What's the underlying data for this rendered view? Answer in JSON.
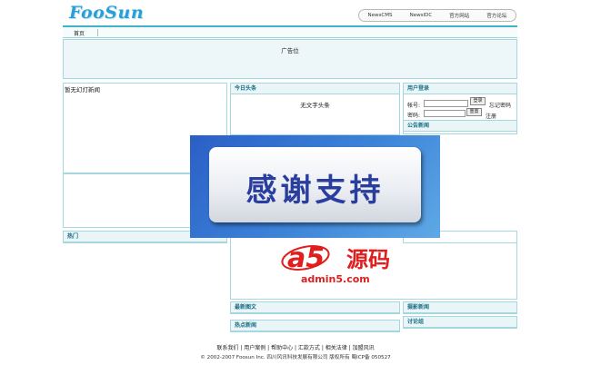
{
  "header": {
    "logo_text": "FooSun",
    "top_links": [
      "NewsCMS",
      "NewsIDC",
      "官方网站",
      "官方论坛"
    ]
  },
  "nav": {
    "home": "首页"
  },
  "ad": {
    "label": "广告位"
  },
  "left": {
    "slide_title": "暂无幻灯新闻",
    "hot_title": "热门"
  },
  "center": {
    "headline_title": "今日头条",
    "headline_empty": "无文字头条",
    "pic_title": "最新图文",
    "hot_news_title": "热点新闻"
  },
  "right": {
    "login_title": "用户登录",
    "account_label": "帐号:",
    "password_label": "密码:",
    "login_button": "登录",
    "reset_button": "重置",
    "forgot_link": "忘记密码",
    "register_link": "注册",
    "notice_title": "公告新闻",
    "photo_title": "摄影新闻",
    "forum_title": "讨论组"
  },
  "overlay": {
    "text": "感谢支持"
  },
  "watermark": {
    "brand": "a5",
    "cn": "源码",
    "url": "admin5.com"
  },
  "footer": {
    "links": "联系我们 | 用户案例 | 帮助中心 | 汇款方式 | 相关法律 | 加盟风讯",
    "copyright": "© 2002-2007 Foosun Inc. 四川风讯科技发展有限公司 版权所有 蜀ICP备 050527"
  },
  "colors": {
    "accent": "#3fb3c8",
    "panel_bg": "#eaf5f8",
    "overlay_blue": "#2a5fc6",
    "watermark_red": "#e01e1e"
  }
}
